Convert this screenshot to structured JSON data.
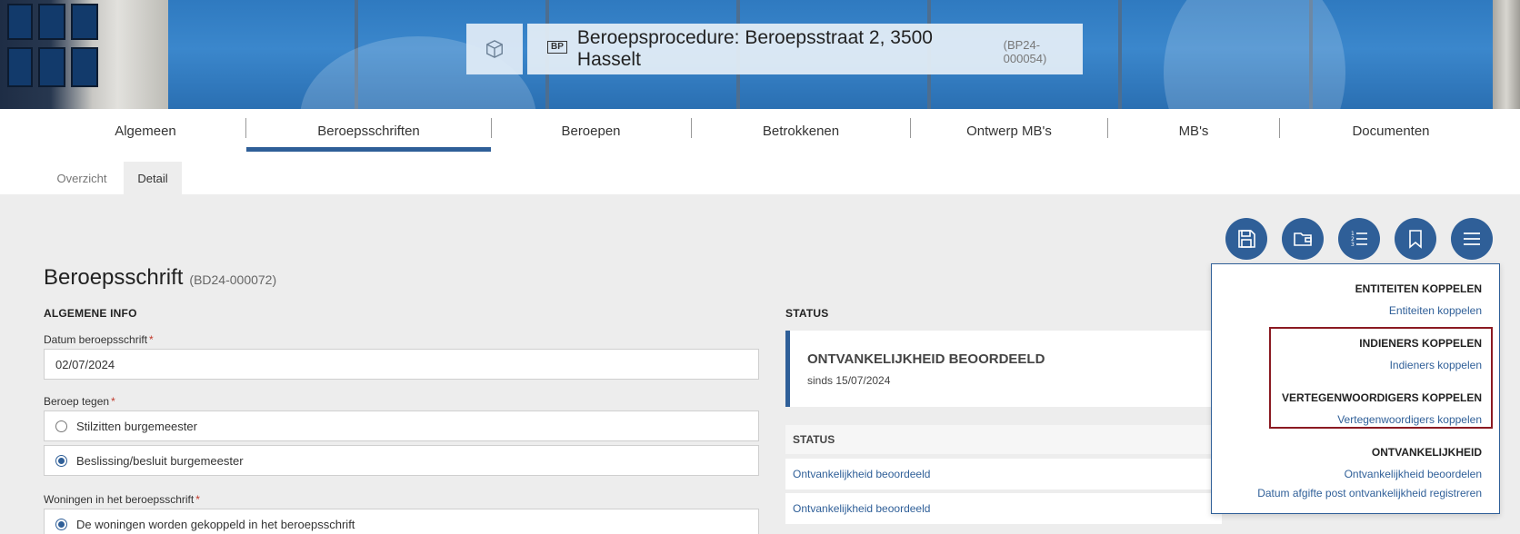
{
  "header": {
    "badge": "BP",
    "title": "Beroepsprocedure: Beroepsstraat 2, 3500 Hasselt",
    "ref": "(BP24-000054)",
    "icon": "box-icon"
  },
  "main_tabs": [
    {
      "label": "Algemeen"
    },
    {
      "label": "Beroepsschriften",
      "active": true
    },
    {
      "label": "Beroepen"
    },
    {
      "label": "Betrokkenen"
    },
    {
      "label": "Ontwerp MB's"
    },
    {
      "label": "MB's"
    },
    {
      "label": "Documenten"
    }
  ],
  "sub_tabs": [
    {
      "label": "Overzicht"
    },
    {
      "label": "Detail",
      "active": true
    }
  ],
  "toolbar": {
    "icons": [
      "save-icon",
      "folder-icon",
      "numbered-list-icon",
      "bookmark-icon",
      "menu-icon"
    ]
  },
  "page": {
    "title": "Beroepsschrift",
    "ref": "(BD24-000072)"
  },
  "general": {
    "heading": "ALGEMENE INFO",
    "date_label": "Datum beroepsschrift",
    "date_value": "02/07/2024",
    "against_label": "Beroep tegen",
    "options": [
      {
        "label": "Stilzitten burgemeester",
        "checked": false
      },
      {
        "label": "Beslissing/besluit burgemeester",
        "checked": true
      }
    ],
    "homes_label": "Woningen in het beroepsschrift",
    "homes_option": "De woningen worden gekoppeld in het beroepsschrift",
    "required_mark": "*"
  },
  "status": {
    "heading": "STATUS",
    "card_title": "ONTVANKELIJKHEID BEOORDEELD",
    "card_since": "sinds 15/07/2024",
    "table_header": "STATUS",
    "rows": [
      "Ontvankelijkheid beoordeeld",
      "Ontvankelijkheid beoordeeld"
    ]
  },
  "menu": {
    "entities_heading": "ENTITEITEN KOPPELEN",
    "entities_link": "Entiteiten koppelen",
    "submitters_heading": "INDIENERS KOPPELEN",
    "submitters_link": "Indieners koppelen",
    "reps_heading": "VERTEGENWOORDIGERS KOPPELEN",
    "reps_link": "Vertegenwoordigers koppelen",
    "admissibility_heading": "ONTVANKELIJKHEID",
    "admissibility_link1": "Ontvankelijkheid beoordelen",
    "admissibility_link2": "Datum afgifte post ontvankelijkheid registreren"
  },
  "colors": {
    "accent": "#2f5f98",
    "highlight_border": "#8b1a22",
    "required": "#c0392b"
  }
}
